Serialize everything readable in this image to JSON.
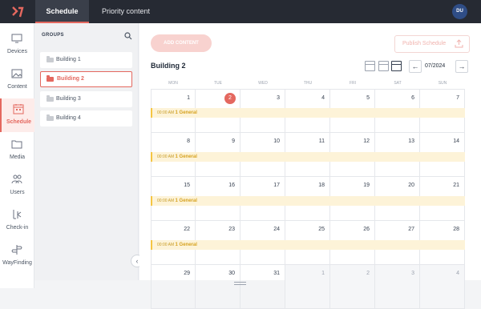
{
  "header": {
    "tabs": [
      {
        "label": "Schedule",
        "active": true
      },
      {
        "label": "Priority content",
        "active": false
      }
    ],
    "avatar_initials": "DU"
  },
  "sidebar": {
    "items": [
      {
        "label": "Devices",
        "icon": "monitor-icon"
      },
      {
        "label": "Content",
        "icon": "image-icon"
      },
      {
        "label": "Schedule",
        "icon": "calendar-icon",
        "active": true
      },
      {
        "label": "Media",
        "icon": "folder-icon"
      },
      {
        "label": "Users",
        "icon": "users-icon"
      },
      {
        "label": "Check-in",
        "icon": "checkin-icon"
      },
      {
        "label": "WayFinding",
        "icon": "wayfinding-icon"
      }
    ]
  },
  "groups": {
    "title": "GROUPS",
    "items": [
      {
        "label": "Building 1"
      },
      {
        "label": "Building 2",
        "selected": true
      },
      {
        "label": "Building 3"
      },
      {
        "label": "Building 4"
      }
    ]
  },
  "main": {
    "add_content_label": "ADD CONTENT",
    "publish_label": "Publish Schedule",
    "calendar_title": "Building 2",
    "month_label": "07/2024",
    "weekdays": [
      "MON",
      "TUE",
      "WED",
      "THU",
      "FRI",
      "SAT",
      "SUN"
    ],
    "weeks": [
      [
        "1",
        "2",
        "3",
        "4",
        "5",
        "6",
        "7"
      ],
      [
        "8",
        "9",
        "10",
        "11",
        "12",
        "13",
        "14"
      ],
      [
        "15",
        "16",
        "17",
        "18",
        "19",
        "20",
        "21"
      ],
      [
        "22",
        "23",
        "24",
        "25",
        "26",
        "27",
        "28"
      ],
      [
        "29",
        "30",
        "31",
        "1",
        "2",
        "3",
        "4"
      ]
    ],
    "today": "2",
    "event": {
      "time": "00:00 AM",
      "title": "1 General"
    }
  },
  "colors": {
    "accent": "#e4685f",
    "topbar": "#262a33",
    "event_bg": "#fdf3d8",
    "event_text": "#d6a21f"
  }
}
